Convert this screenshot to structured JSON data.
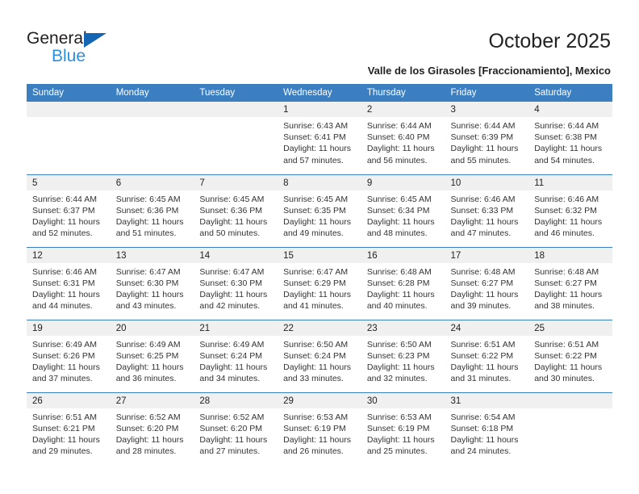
{
  "brand": {
    "name_part1": "General",
    "name_part2": "Blue",
    "triangle_icon": "triangle-icon",
    "accent_dark": "#1565b5",
    "accent_light": "#2b8fe0"
  },
  "header": {
    "title": "October 2025",
    "subtitle": "Valle de los Girasoles [Fraccionamiento], Mexico"
  },
  "calendar": {
    "header_bg": "#3c7fc1",
    "daynum_bg": "#f0f0f0",
    "weekday_headers": [
      "Sunday",
      "Monday",
      "Tuesday",
      "Wednesday",
      "Thursday",
      "Friday",
      "Saturday"
    ],
    "weeks": [
      [
        {
          "day": "",
          "sunrise": "",
          "sunset": "",
          "daylight_line1": "",
          "daylight_line2": ""
        },
        {
          "day": "",
          "sunrise": "",
          "sunset": "",
          "daylight_line1": "",
          "daylight_line2": ""
        },
        {
          "day": "",
          "sunrise": "",
          "sunset": "",
          "daylight_line1": "",
          "daylight_line2": ""
        },
        {
          "day": "1",
          "sunrise": "Sunrise: 6:43 AM",
          "sunset": "Sunset: 6:41 PM",
          "daylight_line1": "Daylight: 11 hours",
          "daylight_line2": "and 57 minutes."
        },
        {
          "day": "2",
          "sunrise": "Sunrise: 6:44 AM",
          "sunset": "Sunset: 6:40 PM",
          "daylight_line1": "Daylight: 11 hours",
          "daylight_line2": "and 56 minutes."
        },
        {
          "day": "3",
          "sunrise": "Sunrise: 6:44 AM",
          "sunset": "Sunset: 6:39 PM",
          "daylight_line1": "Daylight: 11 hours",
          "daylight_line2": "and 55 minutes."
        },
        {
          "day": "4",
          "sunrise": "Sunrise: 6:44 AM",
          "sunset": "Sunset: 6:38 PM",
          "daylight_line1": "Daylight: 11 hours",
          "daylight_line2": "and 54 minutes."
        }
      ],
      [
        {
          "day": "5",
          "sunrise": "Sunrise: 6:44 AM",
          "sunset": "Sunset: 6:37 PM",
          "daylight_line1": "Daylight: 11 hours",
          "daylight_line2": "and 52 minutes."
        },
        {
          "day": "6",
          "sunrise": "Sunrise: 6:45 AM",
          "sunset": "Sunset: 6:36 PM",
          "daylight_line1": "Daylight: 11 hours",
          "daylight_line2": "and 51 minutes."
        },
        {
          "day": "7",
          "sunrise": "Sunrise: 6:45 AM",
          "sunset": "Sunset: 6:36 PM",
          "daylight_line1": "Daylight: 11 hours",
          "daylight_line2": "and 50 minutes."
        },
        {
          "day": "8",
          "sunrise": "Sunrise: 6:45 AM",
          "sunset": "Sunset: 6:35 PM",
          "daylight_line1": "Daylight: 11 hours",
          "daylight_line2": "and 49 minutes."
        },
        {
          "day": "9",
          "sunrise": "Sunrise: 6:45 AM",
          "sunset": "Sunset: 6:34 PM",
          "daylight_line1": "Daylight: 11 hours",
          "daylight_line2": "and 48 minutes."
        },
        {
          "day": "10",
          "sunrise": "Sunrise: 6:46 AM",
          "sunset": "Sunset: 6:33 PM",
          "daylight_line1": "Daylight: 11 hours",
          "daylight_line2": "and 47 minutes."
        },
        {
          "day": "11",
          "sunrise": "Sunrise: 6:46 AM",
          "sunset": "Sunset: 6:32 PM",
          "daylight_line1": "Daylight: 11 hours",
          "daylight_line2": "and 46 minutes."
        }
      ],
      [
        {
          "day": "12",
          "sunrise": "Sunrise: 6:46 AM",
          "sunset": "Sunset: 6:31 PM",
          "daylight_line1": "Daylight: 11 hours",
          "daylight_line2": "and 44 minutes."
        },
        {
          "day": "13",
          "sunrise": "Sunrise: 6:47 AM",
          "sunset": "Sunset: 6:30 PM",
          "daylight_line1": "Daylight: 11 hours",
          "daylight_line2": "and 43 minutes."
        },
        {
          "day": "14",
          "sunrise": "Sunrise: 6:47 AM",
          "sunset": "Sunset: 6:30 PM",
          "daylight_line1": "Daylight: 11 hours",
          "daylight_line2": "and 42 minutes."
        },
        {
          "day": "15",
          "sunrise": "Sunrise: 6:47 AM",
          "sunset": "Sunset: 6:29 PM",
          "daylight_line1": "Daylight: 11 hours",
          "daylight_line2": "and 41 minutes."
        },
        {
          "day": "16",
          "sunrise": "Sunrise: 6:48 AM",
          "sunset": "Sunset: 6:28 PM",
          "daylight_line1": "Daylight: 11 hours",
          "daylight_line2": "and 40 minutes."
        },
        {
          "day": "17",
          "sunrise": "Sunrise: 6:48 AM",
          "sunset": "Sunset: 6:27 PM",
          "daylight_line1": "Daylight: 11 hours",
          "daylight_line2": "and 39 minutes."
        },
        {
          "day": "18",
          "sunrise": "Sunrise: 6:48 AM",
          "sunset": "Sunset: 6:27 PM",
          "daylight_line1": "Daylight: 11 hours",
          "daylight_line2": "and 38 minutes."
        }
      ],
      [
        {
          "day": "19",
          "sunrise": "Sunrise: 6:49 AM",
          "sunset": "Sunset: 6:26 PM",
          "daylight_line1": "Daylight: 11 hours",
          "daylight_line2": "and 37 minutes."
        },
        {
          "day": "20",
          "sunrise": "Sunrise: 6:49 AM",
          "sunset": "Sunset: 6:25 PM",
          "daylight_line1": "Daylight: 11 hours",
          "daylight_line2": "and 36 minutes."
        },
        {
          "day": "21",
          "sunrise": "Sunrise: 6:49 AM",
          "sunset": "Sunset: 6:24 PM",
          "daylight_line1": "Daylight: 11 hours",
          "daylight_line2": "and 34 minutes."
        },
        {
          "day": "22",
          "sunrise": "Sunrise: 6:50 AM",
          "sunset": "Sunset: 6:24 PM",
          "daylight_line1": "Daylight: 11 hours",
          "daylight_line2": "and 33 minutes."
        },
        {
          "day": "23",
          "sunrise": "Sunrise: 6:50 AM",
          "sunset": "Sunset: 6:23 PM",
          "daylight_line1": "Daylight: 11 hours",
          "daylight_line2": "and 32 minutes."
        },
        {
          "day": "24",
          "sunrise": "Sunrise: 6:51 AM",
          "sunset": "Sunset: 6:22 PM",
          "daylight_line1": "Daylight: 11 hours",
          "daylight_line2": "and 31 minutes."
        },
        {
          "day": "25",
          "sunrise": "Sunrise: 6:51 AM",
          "sunset": "Sunset: 6:22 PM",
          "daylight_line1": "Daylight: 11 hours",
          "daylight_line2": "and 30 minutes."
        }
      ],
      [
        {
          "day": "26",
          "sunrise": "Sunrise: 6:51 AM",
          "sunset": "Sunset: 6:21 PM",
          "daylight_line1": "Daylight: 11 hours",
          "daylight_line2": "and 29 minutes."
        },
        {
          "day": "27",
          "sunrise": "Sunrise: 6:52 AM",
          "sunset": "Sunset: 6:20 PM",
          "daylight_line1": "Daylight: 11 hours",
          "daylight_line2": "and 28 minutes."
        },
        {
          "day": "28",
          "sunrise": "Sunrise: 6:52 AM",
          "sunset": "Sunset: 6:20 PM",
          "daylight_line1": "Daylight: 11 hours",
          "daylight_line2": "and 27 minutes."
        },
        {
          "day": "29",
          "sunrise": "Sunrise: 6:53 AM",
          "sunset": "Sunset: 6:19 PM",
          "daylight_line1": "Daylight: 11 hours",
          "daylight_line2": "and 26 minutes."
        },
        {
          "day": "30",
          "sunrise": "Sunrise: 6:53 AM",
          "sunset": "Sunset: 6:19 PM",
          "daylight_line1": "Daylight: 11 hours",
          "daylight_line2": "and 25 minutes."
        },
        {
          "day": "31",
          "sunrise": "Sunrise: 6:54 AM",
          "sunset": "Sunset: 6:18 PM",
          "daylight_line1": "Daylight: 11 hours",
          "daylight_line2": "and 24 minutes."
        },
        {
          "day": "",
          "sunrise": "",
          "sunset": "",
          "daylight_line1": "",
          "daylight_line2": ""
        }
      ]
    ]
  }
}
